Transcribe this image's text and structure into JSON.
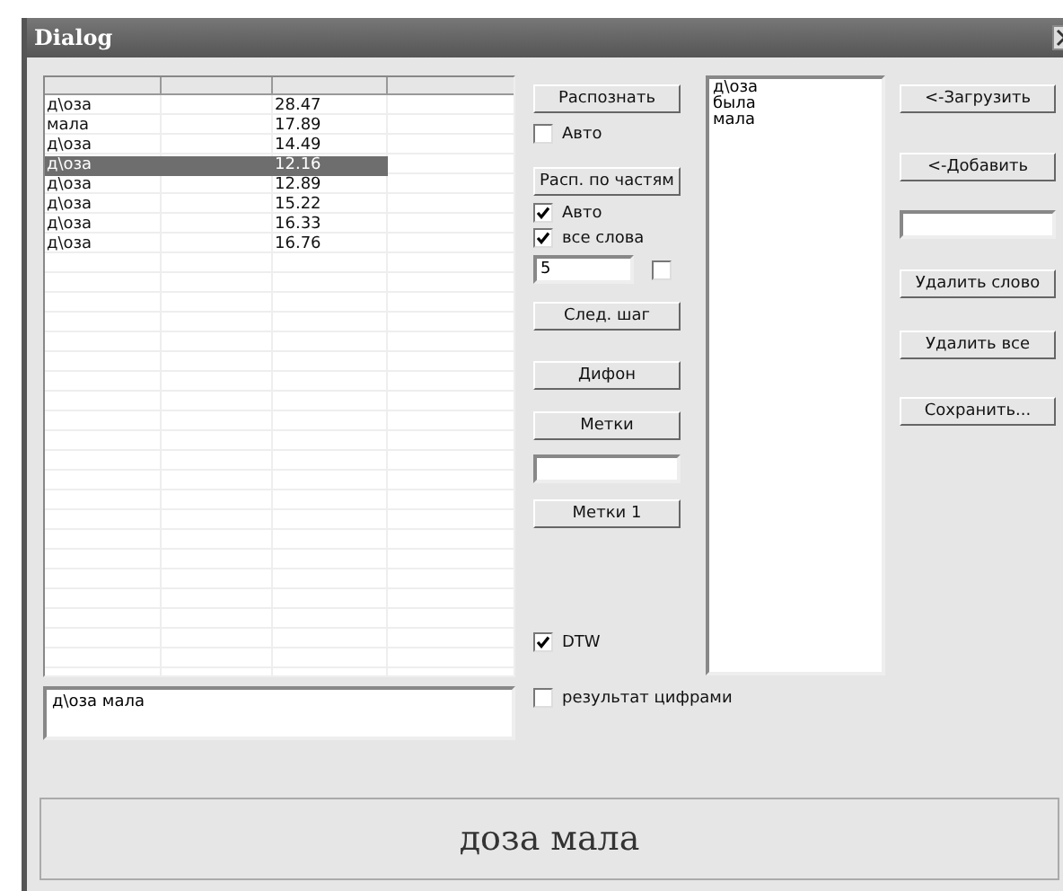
{
  "window": {
    "title": "Dialog"
  },
  "table": {
    "rows": [
      {
        "cells": [
          "д\\оза",
          "28.47"
        ],
        "selected": false
      },
      {
        "cells": [
          "мала",
          "17.89"
        ],
        "selected": false
      },
      {
        "cells": [
          "д\\оза",
          "14.49"
        ],
        "selected": false
      },
      {
        "cells": [
          "д\\оза",
          "12.16"
        ],
        "selected": true
      },
      {
        "cells": [
          "д\\оза",
          "12.89"
        ],
        "selected": false
      },
      {
        "cells": [
          "д\\оза",
          "15.22"
        ],
        "selected": false
      },
      {
        "cells": [
          "д\\оза",
          "16.33"
        ],
        "selected": false
      },
      {
        "cells": [
          "д\\оза",
          "16.76"
        ],
        "selected": false
      }
    ]
  },
  "result_text": "д\\оза мала",
  "controls": [
    {
      "kind": "button",
      "label": "Распознать"
    },
    {
      "kind": "checkbox",
      "label": "Авто",
      "checked": false
    },
    {
      "kind": "button",
      "label": "Расп. по частям"
    },
    {
      "kind": "checkbox",
      "label": "Авто",
      "checked": true
    },
    {
      "kind": "checkbox",
      "label": "все слова",
      "checked": true
    },
    {
      "kind": "number",
      "value": "5",
      "checked": false
    },
    {
      "kind": "button",
      "label": "След. шаг"
    },
    {
      "kind": "button",
      "label": "Дифон"
    },
    {
      "kind": "button",
      "label": "Метки"
    },
    {
      "kind": "input"
    },
    {
      "kind": "button",
      "label": "Метки 1"
    },
    {
      "kind": "checkbox",
      "label": "DTW",
      "checked": true
    },
    {
      "kind": "checkbox",
      "label": "результат цифрами",
      "checked": false
    }
  ],
  "word_list": [
    "д\\оза",
    "была",
    "мала"
  ],
  "right_controls": [
    {
      "kind": "button",
      "label": "<-Загрузить"
    },
    {
      "kind": "button",
      "label": "<-Добавить"
    },
    {
      "kind": "input"
    },
    {
      "kind": "button",
      "label": "Удалить слово"
    },
    {
      "kind": "button",
      "label": "Удалить все"
    },
    {
      "kind": "button",
      "label": "Сохранить..."
    }
  ],
  "recognized": "доза мала"
}
